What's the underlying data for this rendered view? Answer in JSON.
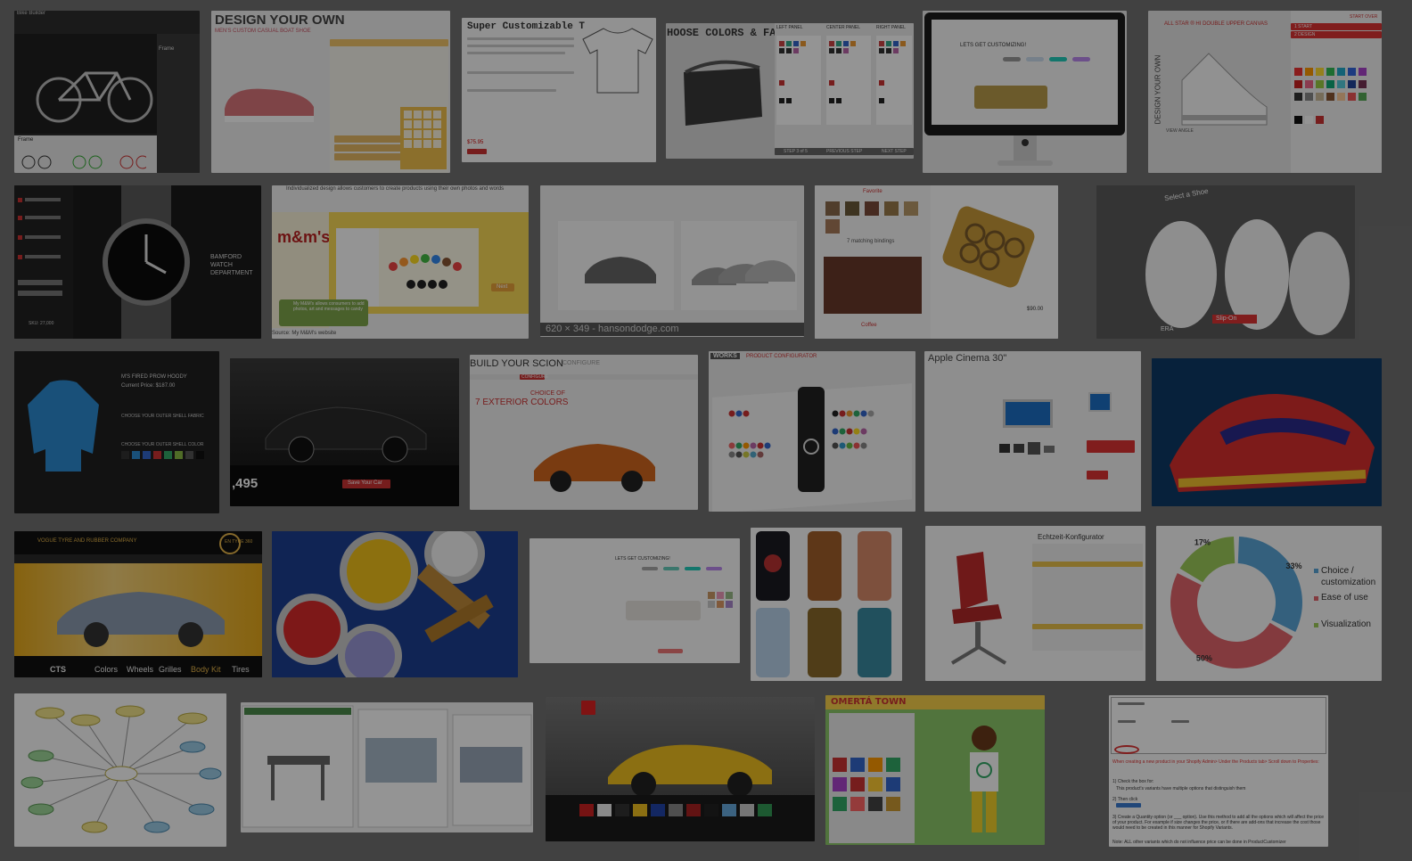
{
  "tiles": {
    "bike": {
      "title": "Bike Builder",
      "panel_label": "Frame",
      "sub_label": "Frame"
    },
    "shoe": {
      "heading": "DESIGN YOUR OWN",
      "subheading": "MEN'S CUSTOM CASUAL BOAT SHOE"
    },
    "tshirt": {
      "heading": "Super Customizable T",
      "price": "$75.95"
    },
    "bag": {
      "heading": "HOOSE COLORS & FABRICS",
      "col1": "LEFT PANEL",
      "col2": "CENTER PANEL",
      "col3": "RIGHT PANEL",
      "btn1": "STEP 3 of 5",
      "btn2": "PREVIOUS STEP",
      "btn3": "NEXT STEP"
    },
    "imac": {
      "heading": "LETS GET CUSTOMIZING!"
    },
    "converse": {
      "heading": "ALL STAR ® HI DOUBLE UPPER CANVAS",
      "side_text": "DESIGN YOUR OWN",
      "start_over": "START OVER",
      "step1": "1  START",
      "step2": "2  DESIGN",
      "view": "VIEW ANGLE"
    },
    "watch": {
      "brand": "BAMFORD WATCH DEPARTMENT",
      "price": "SKU: 27,000"
    },
    "mms": {
      "caption_top": "Individualized design allows customers to create products using their own photos and words",
      "bubble": "My M&M's allows consumers to add photos, art and messages to candy",
      "source": "Source: My M&M's website",
      "next": "Next"
    },
    "cars": {
      "caption": "620 × 349 - hansondodge.com"
    },
    "fabric": {
      "label": "Favorite",
      "sub": "7 matching bindings",
      "name": "Coffee",
      "price": "$90.00"
    },
    "vans": {
      "label1": "Select a Shoe",
      "label2": "Slip-On",
      "label3": "ERA"
    },
    "hoody": {
      "title": "M'S FIRED PROW HOODY",
      "price": "Current Price: $187.00",
      "label1": "CHOOSE YOUR OUTER SHELL FABRIC",
      "label2": "CHOOSE YOUR OUTER SHELL COLOR"
    },
    "mustang": {
      "price": ",495",
      "btn": "Save Your Car"
    },
    "scion": {
      "heading": "BUILD YOUR SCION",
      "heading2": "CONFIGURE",
      "tab": "CONFIGURE",
      "choice": "CHOICE OF",
      "colors": "7 EXTERIOR COLORS"
    },
    "bottle": {
      "brand": "WORKS",
      "heading": "PRODUCT CONFIGURATOR"
    },
    "cinema": {
      "heading": "Apple Cinema 30\""
    },
    "adidas": {},
    "cadillac": {
      "brand": "VOGUE TYRE AND RUBBER COMPANY",
      "badge": "EN TYRE 360",
      "model": "CTS",
      "tabs": [
        "Colors",
        "Wheels",
        "Grilles",
        "Body Kit",
        "Tires"
      ]
    },
    "paint": {},
    "sofa": {
      "heading": "LETS GET CUSTOMIZING!"
    },
    "phones": {},
    "chair": {
      "heading": "Echtzeit-Konfigurator"
    },
    "donut": {
      "pct1": "17%",
      "pct2": "33%",
      "pct3": "50%",
      "legend1": "Choice / customization",
      "legend2": "Ease of use",
      "legend3": "Visualization"
    },
    "mindmap": {},
    "kitchen": {},
    "tesla": {},
    "game": {
      "heading": "OMERTÁ TOWN"
    },
    "shopify": {
      "text1": "When creating a new product in your Shopify Admin> Under the Products tab> Scroll down to Properties:",
      "text2": "1) Check the box for:",
      "text3": "This product's variants have multiple options that distinguish them",
      "text4": "2) Then click",
      "text5": "3) Create a Quantity option (or ___ option). Use this method to add all the options which will affect the price of your product. For example if size changes the price, or if there are add-ons that increase the cost those would need to be created in this manner for Shopify Variants.",
      "text6": "Note: ALL other variants which do not influence price can be done in ProductCustomizer"
    }
  },
  "chart_data": {
    "type": "pie",
    "categories": [
      "Choice / customization",
      "Ease of use",
      "Visualization"
    ],
    "values": [
      33,
      50,
      17
    ],
    "title": ""
  },
  "colors": {
    "bg": "#717171",
    "overlay": "rgba(0,0,0,0.42)"
  }
}
